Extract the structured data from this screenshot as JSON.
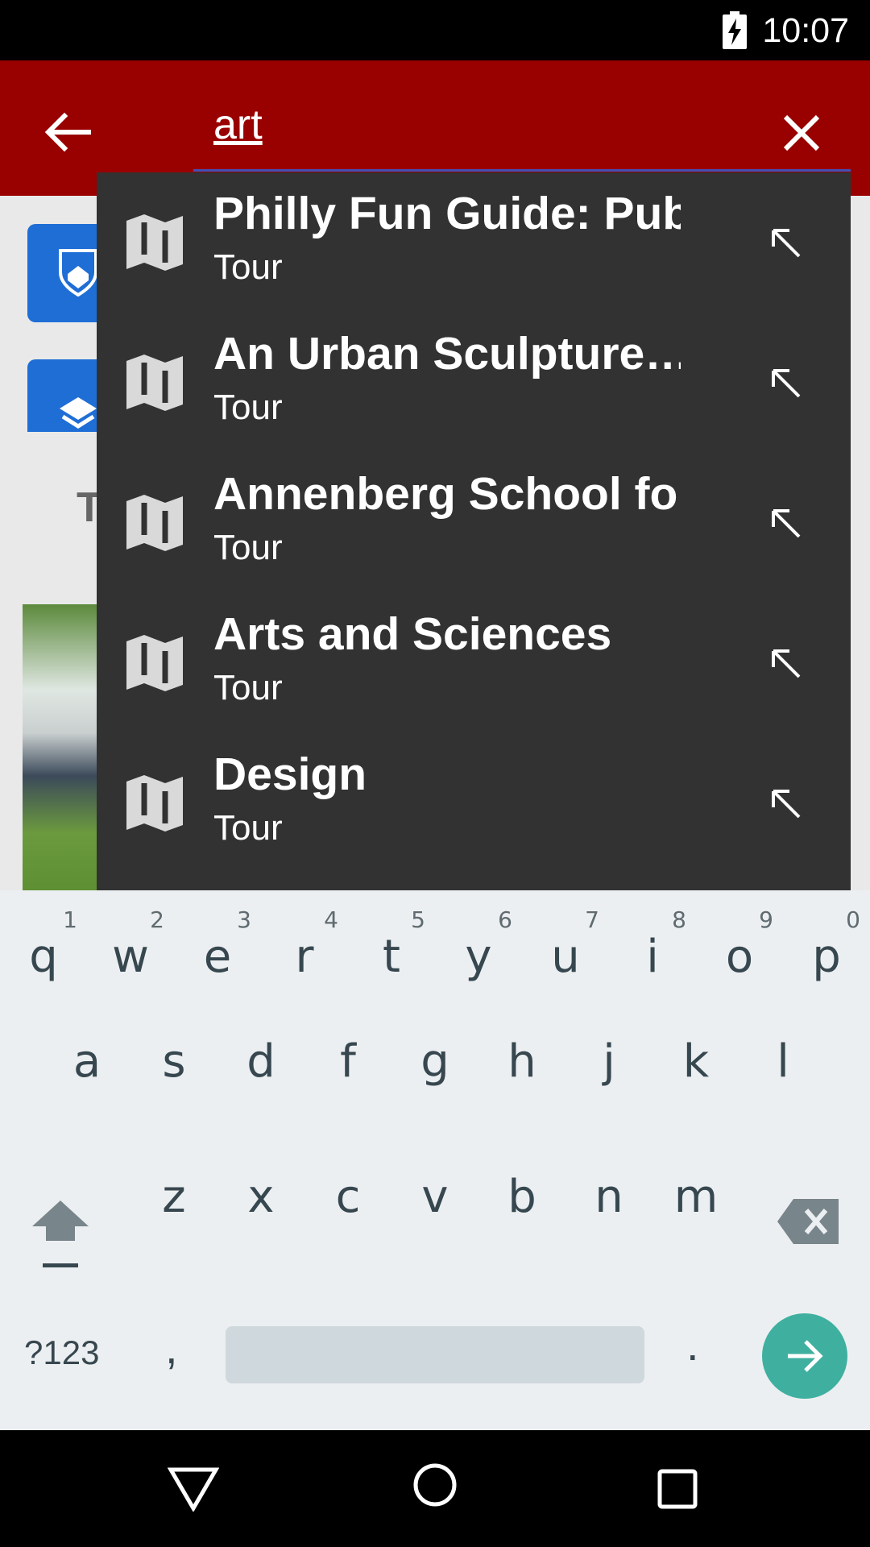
{
  "status_bar": {
    "time": "10:07",
    "battery_icon": "battery-charging-icon"
  },
  "search": {
    "query": "art"
  },
  "background": {
    "heading_letter": "T"
  },
  "suggestions": [
    {
      "title": "Philly Fun Guide: Pub…",
      "subtitle": "Tour"
    },
    {
      "title": "An Urban Sculpture…",
      "subtitle": "Tour"
    },
    {
      "title": "Annenberg School fo…",
      "subtitle": "Tour"
    },
    {
      "title": "Arts and Sciences",
      "subtitle": "Tour"
    },
    {
      "title": "Design",
      "subtitle": "Tour"
    }
  ],
  "keyboard": {
    "row1": [
      {
        "ch": "q",
        "hint": "1"
      },
      {
        "ch": "w",
        "hint": "2"
      },
      {
        "ch": "e",
        "hint": "3"
      },
      {
        "ch": "r",
        "hint": "4"
      },
      {
        "ch": "t",
        "hint": "5"
      },
      {
        "ch": "y",
        "hint": "6"
      },
      {
        "ch": "u",
        "hint": "7"
      },
      {
        "ch": "i",
        "hint": "8"
      },
      {
        "ch": "o",
        "hint": "9"
      },
      {
        "ch": "p",
        "hint": "0"
      }
    ],
    "row2": [
      "a",
      "s",
      "d",
      "f",
      "g",
      "h",
      "j",
      "k",
      "l"
    ],
    "row3": [
      "z",
      "x",
      "c",
      "v",
      "b",
      "n",
      "m"
    ],
    "symbols_label": "?123",
    "comma_label": ",",
    "period_label": "."
  },
  "colors": {
    "app_bar": "#990000",
    "dropdown": "#323232",
    "go_key": "#3fb0a0"
  }
}
